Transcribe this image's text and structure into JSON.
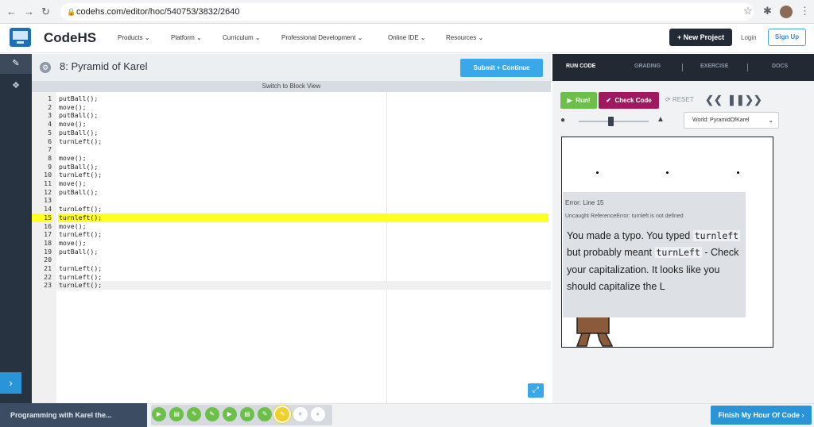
{
  "browser": {
    "url": "codehs.com/editor/hoc/540753/3832/2640"
  },
  "header": {
    "brand": "CodeHS",
    "menu": [
      {
        "label": "Products"
      },
      {
        "label": "Platform"
      },
      {
        "label": "Curriculum"
      },
      {
        "label": "Professional Development"
      },
      {
        "label": "Online IDE"
      },
      {
        "label": "Resources"
      }
    ],
    "new_project": "New Project",
    "login": "Login",
    "signup": "Sign Up"
  },
  "editor": {
    "exercise_title": "8: Pyramid of Karel",
    "submit_label": "Submit + Continue",
    "switch_view": "Switch to Block View",
    "error_line": 15,
    "lines": [
      {
        "n": "1",
        "code": "putBall();"
      },
      {
        "n": "2",
        "code": "move();"
      },
      {
        "n": "3",
        "code": "putBall();"
      },
      {
        "n": "4",
        "code": "move();"
      },
      {
        "n": "5",
        "code": "putBall();"
      },
      {
        "n": "6",
        "code": "turnLeft();"
      },
      {
        "n": "7",
        "code": ""
      },
      {
        "n": "8",
        "code": "move();"
      },
      {
        "n": "9",
        "code": "putBall();"
      },
      {
        "n": "10",
        "code": "turnLeft();"
      },
      {
        "n": "11",
        "code": "move();"
      },
      {
        "n": "12",
        "code": "putBall();"
      },
      {
        "n": "13",
        "code": ""
      },
      {
        "n": "14",
        "code": "turnLeft();"
      },
      {
        "n": "15",
        "code": "turnleft();"
      },
      {
        "n": "16",
        "code": "move();"
      },
      {
        "n": "17",
        "code": "turnLeft();"
      },
      {
        "n": "18",
        "code": "move();"
      },
      {
        "n": "19",
        "code": "putBall();"
      },
      {
        "n": "20",
        "code": ""
      },
      {
        "n": "21",
        "code": "turnLeft();"
      },
      {
        "n": "22",
        "code": "turnLeft();"
      },
      {
        "n": "23",
        "code": "turnLeft();"
      }
    ]
  },
  "panel": {
    "tabs": [
      "RUN CODE",
      "GRADING",
      "EXERCISE",
      "DOCS"
    ],
    "run": "Run!",
    "check": "Check Code",
    "reset": "RESET",
    "world": "World: PyramidOfKarel",
    "error": {
      "title": "Error: Line 15",
      "detail": "Uncaught ReferenceError: turnleft is not defined",
      "msg_1": "You made a typo. You typed ",
      "typed": "turnleft",
      "msg_2": " but probably meant ",
      "meant": "turnLeft",
      "msg_3": " - Check your capitalization. It looks like you should capitalize the L"
    }
  },
  "bottom": {
    "course": "Programming with Karel the...",
    "finish": "Finish My Hour Of Code",
    "progress": [
      "video",
      "doc",
      "code",
      "code",
      "video",
      "doc",
      "code",
      "code-current",
      "star",
      "circle"
    ]
  },
  "colors": {
    "accent": "#3aa7e8",
    "run": "#6cc04a",
    "check": "#a0195e",
    "error_highlight": "#ffff22"
  }
}
